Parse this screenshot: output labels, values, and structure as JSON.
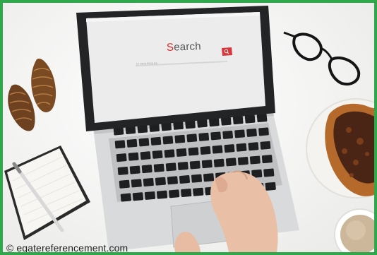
{
  "screen": {
    "search_word_first": "S",
    "search_word_rest": "earch",
    "search_placeholder": "Ici votre thing kis"
  },
  "watermark": "© egatereferencement.com",
  "colors": {
    "frame_border": "#2ea84a",
    "search_accent": "#d92b2b",
    "search_button": "#d9363b"
  },
  "icons": {
    "search_button": "search-icon"
  }
}
